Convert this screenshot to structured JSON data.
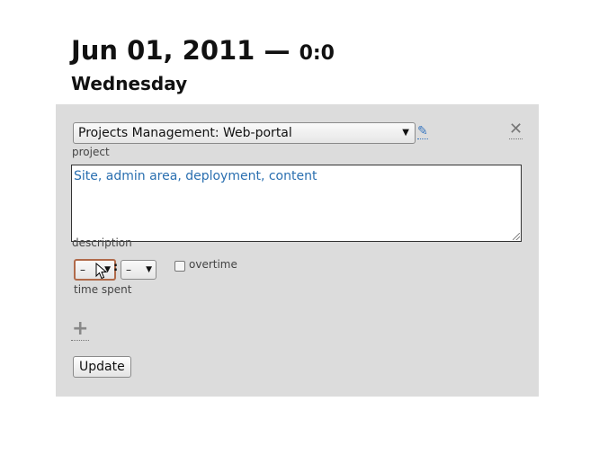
{
  "header": {
    "date": "Jun 01, 2011 —",
    "time": "0:0",
    "weekday": "Wednesday"
  },
  "form": {
    "project_value": "Projects Management: Web-portal",
    "project_label": "project",
    "edit_icon": "pencil-icon",
    "close_icon": "close-icon",
    "description_value": "Site, admin area, deployment, content",
    "description_label": "description",
    "hours_value": "–",
    "minutes_value": "–",
    "time_separator": ":",
    "time_label": "time spent",
    "overtime_label": "overtime",
    "overtime_checked": false,
    "add_icon": "plus-icon",
    "update_label": "Update"
  },
  "colors": {
    "panel_bg": "#dcdcdc",
    "link": "#3a78c0",
    "focus_border": "#b06a4a"
  }
}
